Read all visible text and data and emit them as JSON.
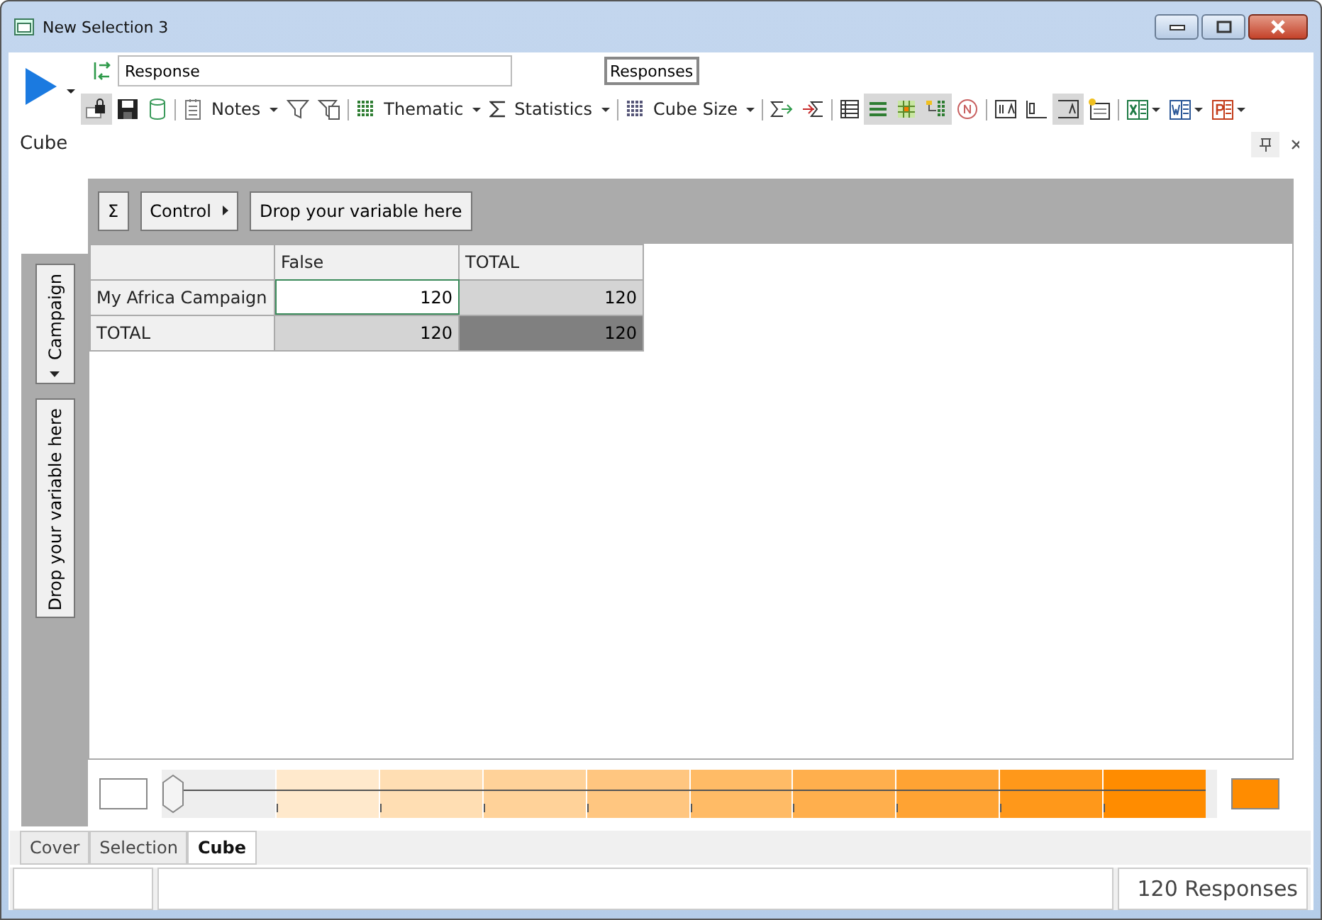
{
  "window": {
    "title": "New Selection 3"
  },
  "query": {
    "value": "Response",
    "button": "Responses"
  },
  "toolbar": [
    {
      "kind": "button",
      "selected": true
    },
    {
      "kind": "button",
      "selected": false
    },
    {
      "kind": "button",
      "selected": false
    },
    {
      "kind": "separator"
    },
    {
      "kind": "button",
      "selected": false
    },
    {
      "kind": "menu",
      "label": "Notes"
    },
    {
      "kind": "button",
      "selected": false
    },
    {
      "kind": "button",
      "selected": false
    },
    {
      "kind": "separator"
    },
    {
      "kind": "button",
      "selected": false
    },
    {
      "kind": "menu",
      "label": "Thematic"
    },
    {
      "kind": "button",
      "selected": false
    },
    {
      "kind": "menu",
      "label": "Statistics"
    },
    {
      "kind": "separator"
    },
    {
      "kind": "button",
      "selected": false
    },
    {
      "kind": "menu",
      "label": "Cube Size"
    },
    {
      "kind": "separator"
    },
    {
      "kind": "button",
      "selected": false
    },
    {
      "kind": "button",
      "selected": false
    },
    {
      "kind": "separator"
    },
    {
      "kind": "button",
      "selected": false
    },
    {
      "kind": "button",
      "selected": true
    },
    {
      "kind": "button",
      "selected": true
    },
    {
      "kind": "button",
      "selected": true
    },
    {
      "kind": "button",
      "selected": false
    },
    {
      "kind": "separator"
    },
    {
      "kind": "button",
      "selected": false
    },
    {
      "kind": "button",
      "selected": false
    },
    {
      "kind": "button",
      "selected": true
    },
    {
      "kind": "button",
      "selected": false
    },
    {
      "kind": "separator"
    },
    {
      "kind": "split",
      "selected": false
    },
    {
      "kind": "split",
      "selected": false
    },
    {
      "kind": "split",
      "selected": false
    }
  ],
  "panel": {
    "title": "Cube"
  },
  "pivot": {
    "sigma": "Σ",
    "control": "Control",
    "column_drop": "Drop your variable here",
    "row_variable": "Campaign",
    "row_drop": "Drop your variable here",
    "columns": [
      "False",
      "TOTAL"
    ],
    "rows": [
      {
        "label": "My Africa Campaign",
        "cells": [
          {
            "value": "120",
            "color": "#ffffff",
            "selected": true
          },
          {
            "value": "120",
            "color": "#d4d4d4",
            "selected": false
          }
        ]
      },
      {
        "label": "TOTAL",
        "cells": [
          {
            "value": "120",
            "color": "#d4d4d4",
            "selected": false
          },
          {
            "value": "120",
            "color": "#808080",
            "selected": false
          }
        ]
      }
    ]
  },
  "legend": {
    "level": 0
  },
  "tabs": [
    {
      "label": "Cover",
      "selected": false
    },
    {
      "label": "Selection",
      "selected": false
    },
    {
      "label": "Cube",
      "selected": true
    }
  ],
  "status_bar": {
    "text": "120 Responses"
  }
}
